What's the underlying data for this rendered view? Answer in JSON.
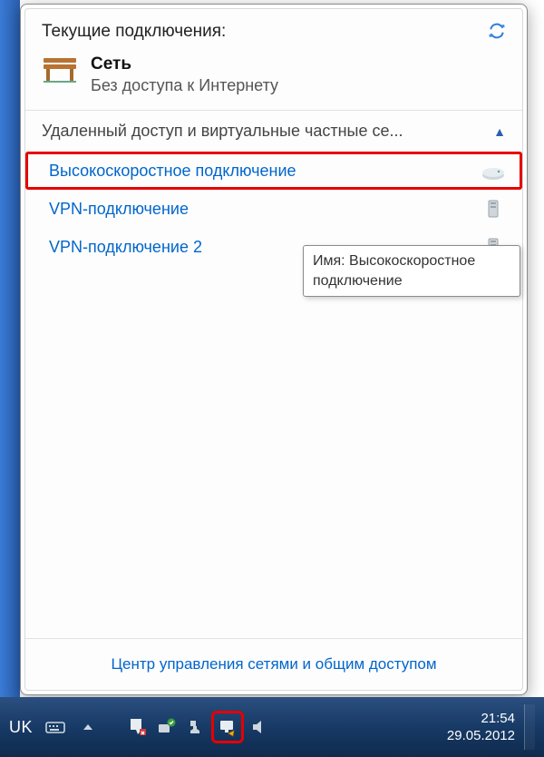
{
  "header": {
    "title": "Текущие подключения:"
  },
  "network": {
    "name": "Сеть",
    "status": "Без доступа к Интернету"
  },
  "category": {
    "label": "Удаленный доступ и виртуальные частные се..."
  },
  "connections": [
    {
      "label": "Высокоскоростное подключение",
      "selected": true
    },
    {
      "label": "VPN-подключение",
      "selected": false
    },
    {
      "label": "VPN-подключение 2",
      "selected": false
    }
  ],
  "tooltip": {
    "text": "Имя: Высокоскоростное подключение"
  },
  "footer": {
    "link": "Центр управления сетями и общим доступом"
  },
  "taskbar": {
    "lang": "UK",
    "time": "21:54",
    "date": "29.05.2012"
  }
}
